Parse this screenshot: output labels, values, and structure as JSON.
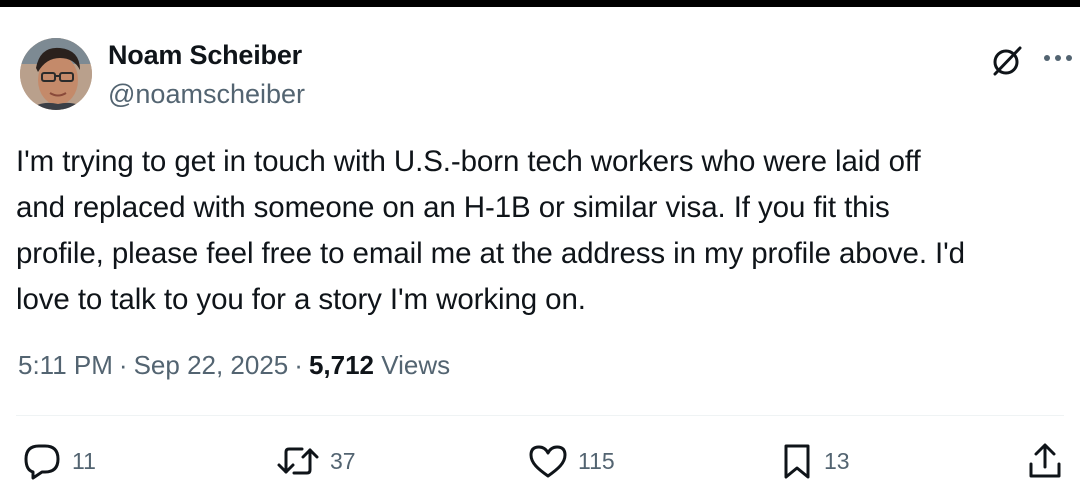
{
  "author": {
    "display_name": "Noam Scheiber",
    "handle": "@noamscheiber"
  },
  "tweet": {
    "lines": [
      "I'm trying to get in touch with U.S.-born tech workers who were laid off",
      "and replaced with someone on an H-1B or similar visa. If you fit this",
      "profile, please feel free to email me at the address in my profile above. I'd",
      "love to talk to you for a story I'm working on."
    ],
    "time": "5:11 PM",
    "date": "Sep 22, 2025",
    "separator": "·",
    "views_count": "5,712",
    "views_label": "Views"
  },
  "actions": {
    "replies": "11",
    "reposts": "37",
    "likes": "115",
    "bookmarks": "13"
  },
  "icons": {
    "grok": "grok-icon",
    "more": "more-icon",
    "reply": "reply-icon",
    "repost": "repost-icon",
    "like": "heart-icon",
    "bookmark": "bookmark-icon",
    "share": "share-icon"
  },
  "colors": {
    "text": "#0f1419",
    "secondary": "#536471",
    "divider": "#eff3f4"
  }
}
